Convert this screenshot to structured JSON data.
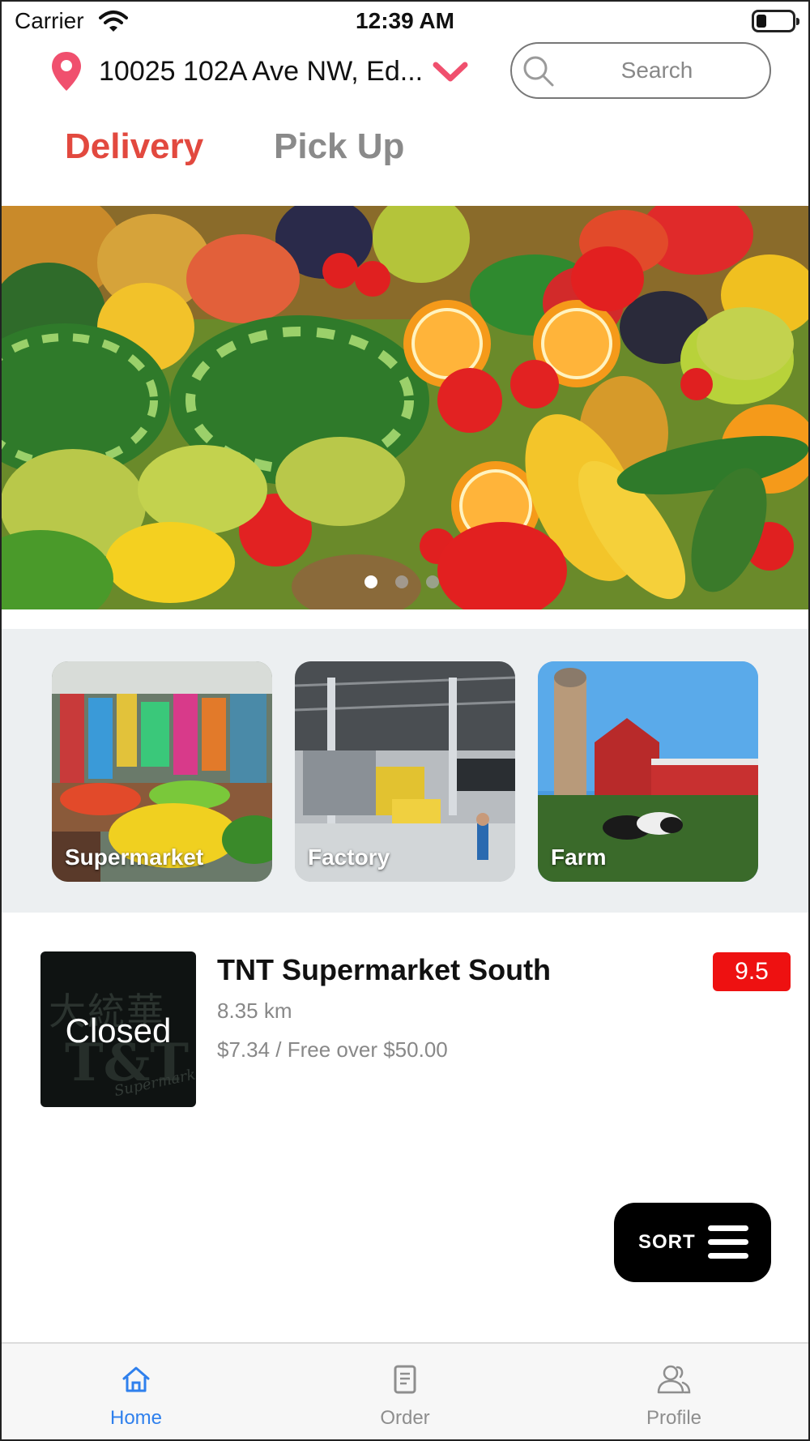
{
  "status_bar": {
    "carrier": "Carrier",
    "time": "12:39 AM",
    "battery_level": 0.2
  },
  "header": {
    "address": "10025 102A Ave NW, Ed...",
    "search_placeholder": "Search"
  },
  "tabs": [
    {
      "label": "Delivery",
      "active": true
    },
    {
      "label": "Pick Up",
      "active": false
    }
  ],
  "banner": {
    "slide_count": 3,
    "active_slide": 1
  },
  "categories": [
    {
      "label": "Supermarket"
    },
    {
      "label": "Factory"
    },
    {
      "label": "Farm"
    }
  ],
  "stores": [
    {
      "name": "TNT Supermarket South",
      "distance": "8.35 km",
      "fee": "$7.34 / Free over $50.00",
      "rating": "9.5",
      "status": "Closed",
      "logo_text": "大統華"
    }
  ],
  "sort_button": {
    "label": "SORT"
  },
  "tab_bar": [
    {
      "label": "Home",
      "icon": "home-icon",
      "active": true
    },
    {
      "label": "Order",
      "icon": "order-icon",
      "active": false
    },
    {
      "label": "Profile",
      "icon": "profile-icon",
      "active": false
    }
  ],
  "colors": {
    "accent": "#e2493f",
    "tab_active": "#2f80ed",
    "rating_badge": "#ee1111",
    "pin": "#f0506e"
  }
}
